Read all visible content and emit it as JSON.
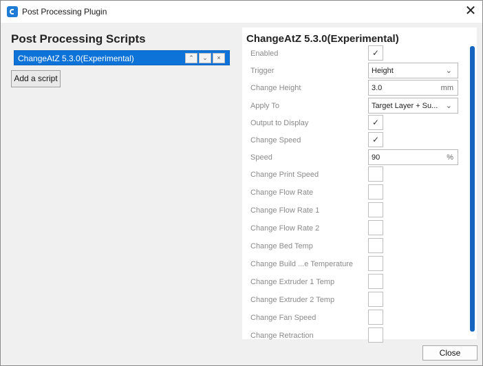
{
  "window": {
    "title": "Post Processing Plugin",
    "close_glyph": "✕"
  },
  "left": {
    "heading": "Post Processing Scripts",
    "selected_script": "ChangeAtZ 5.3.0(Experimental)",
    "up_glyph": "⌃",
    "down_glyph": "⌄",
    "remove_glyph": "×",
    "add_button": "Add a script"
  },
  "right": {
    "title": "ChangeAtZ 5.3.0(Experimental)",
    "rows": [
      {
        "label": "Enabled",
        "type": "checkbox",
        "checked": "✓"
      },
      {
        "label": "Trigger",
        "type": "select",
        "value": "Height",
        "chev": "⌄"
      },
      {
        "label": "Change Height",
        "type": "text",
        "value": "3.0",
        "unit": "mm"
      },
      {
        "label": "Apply To",
        "type": "select",
        "value": "Target Layer + Su...",
        "chev": "⌄"
      },
      {
        "label": "Output to Display",
        "type": "checkbox",
        "checked": "✓"
      },
      {
        "label": "Change Speed",
        "type": "checkbox",
        "checked": "✓"
      },
      {
        "label": "Speed",
        "type": "text",
        "value": "90",
        "unit": "%"
      },
      {
        "label": "Change Print Speed",
        "type": "checkbox",
        "checked": ""
      },
      {
        "label": "Change Flow Rate",
        "type": "checkbox",
        "checked": ""
      },
      {
        "label": "Change Flow Rate 1",
        "type": "checkbox",
        "checked": ""
      },
      {
        "label": "Change Flow Rate 2",
        "type": "checkbox",
        "checked": ""
      },
      {
        "label": "Change Bed Temp",
        "type": "checkbox",
        "checked": ""
      },
      {
        "label": "Change Build ...e Temperature",
        "type": "checkbox",
        "checked": ""
      },
      {
        "label": "Change Extruder 1 Temp",
        "type": "checkbox",
        "checked": ""
      },
      {
        "label": "Change Extruder 2 Temp",
        "type": "checkbox",
        "checked": ""
      },
      {
        "label": "Change Fan Speed",
        "type": "checkbox",
        "checked": ""
      },
      {
        "label": "Change Retraction",
        "type": "checkbox",
        "checked": ""
      }
    ]
  },
  "footer": {
    "close_button": "Close"
  },
  "colors": {
    "accent": "#0e73d8",
    "scrollbar": "#1565c0"
  }
}
